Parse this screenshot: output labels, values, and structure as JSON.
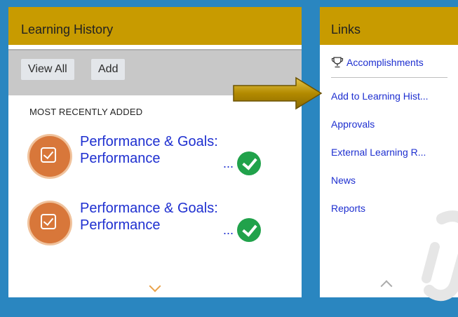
{
  "learning_history": {
    "title": "Learning History",
    "buttons": {
      "view_all": "View All",
      "add": "Add"
    },
    "section_label": "MOST RECENTLY ADDED",
    "items": [
      {
        "line1": "Performance & Goals:",
        "line2": "Performance",
        "more": "...",
        "status_icon": "check-circle-icon"
      },
      {
        "line1": "Performance & Goals:",
        "line2": "Performance",
        "more": "...",
        "status_icon": "check-circle-icon"
      }
    ]
  },
  "links": {
    "title": "Links",
    "items": [
      {
        "label": "Accomplishments",
        "icon": "trophy-icon"
      },
      {
        "label": "Add to Learning Hist..."
      },
      {
        "label": "Approvals"
      },
      {
        "label": "External Learning R..."
      },
      {
        "label": "News"
      },
      {
        "label": "Reports"
      }
    ]
  },
  "colors": {
    "header_bg": "#c89b00",
    "page_bg": "#2a86c0",
    "link_blue": "#1e2fd0",
    "badge_orange": "#d8773a",
    "check_green": "#21a24b",
    "arrow_gold": "#c9a100"
  }
}
